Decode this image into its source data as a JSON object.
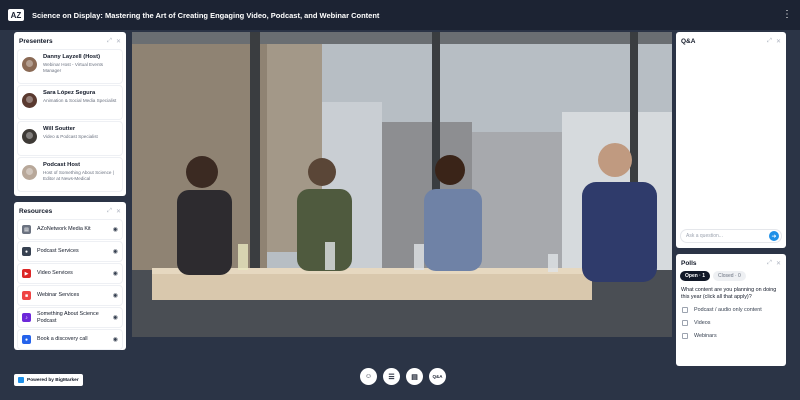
{
  "header": {
    "logo_text": "AZ",
    "title": "Science on Display: Mastering the Art of Creating Engaging Video, Podcast, and Webinar Content",
    "menu_glyph": "⋮"
  },
  "presenters": {
    "title": "Presenters",
    "items": [
      {
        "name": "Danny Layzell (Host)",
        "role": "Webinar Host - Virtual Events Manager",
        "avatar_color": "#8a6a55"
      },
      {
        "name": "Sara López Segura",
        "role": "Animation & Social Media Specialist",
        "avatar_color": "#5a3a30"
      },
      {
        "name": "Will Soutter",
        "role": "Video & Podcast Specialist",
        "avatar_color": "#3e3a36"
      },
      {
        "name": "Podcast Host",
        "role": "Host of Something About Science | Editor at News-Medical",
        "avatar_color": "#b8a89a"
      }
    ]
  },
  "resources": {
    "title": "Resources",
    "items": [
      {
        "label": "AZoNetwork Media Kit",
        "icon_color": "#6b7280",
        "icon_glyph": "▤"
      },
      {
        "label": "Podcast Services",
        "icon_color": "#374151",
        "icon_glyph": "●"
      },
      {
        "label": "Video Services",
        "icon_color": "#dc2626",
        "icon_glyph": "▶"
      },
      {
        "label": "Webinar Services",
        "icon_color": "#ef4444",
        "icon_glyph": "■"
      },
      {
        "label": "Something About Science Podcast",
        "icon_color": "#6d28d9",
        "icon_glyph": "♪"
      },
      {
        "label": "Book a discovery call",
        "icon_color": "#2563eb",
        "icon_glyph": "●"
      }
    ]
  },
  "qa": {
    "title": "Q&A",
    "input_placeholder": "Ask a question..."
  },
  "polls": {
    "title": "Polls",
    "tab_open": "Open · 1",
    "tab_closed": "Closed · 0",
    "question": "What content are you planning on doing this year (click all that apply)?",
    "options": [
      "Podcast / audio only content",
      "Videos",
      "Webinars"
    ]
  },
  "footer": {
    "powered_by": "Powered by BigMarker",
    "toolbar": [
      {
        "name": "people-icon",
        "glyph": "☺"
      },
      {
        "name": "checklist-icon",
        "glyph": "☰"
      },
      {
        "name": "document-icon",
        "glyph": "▤"
      },
      {
        "name": "qa-icon",
        "glyph": "Q&A"
      }
    ]
  }
}
